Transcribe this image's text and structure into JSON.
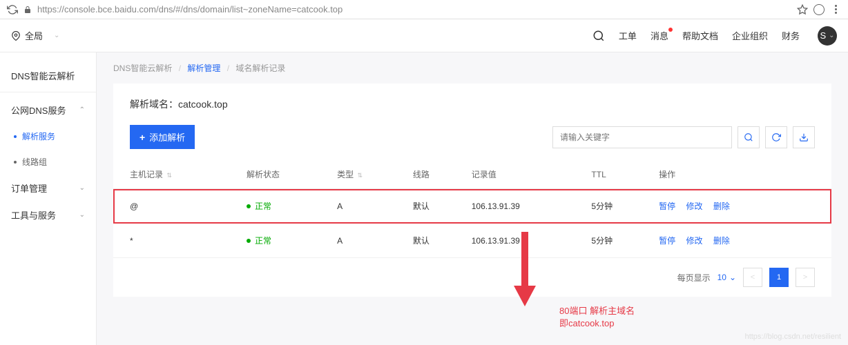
{
  "browser": {
    "url": "https://console.bce.baidu.com/dns/#/dns/domain/list~zoneName=catcook.top"
  },
  "header": {
    "region": "全局",
    "links": {
      "workorder": "工单",
      "messages": "消息",
      "help": "帮助文档",
      "org": "企业组织",
      "finance": "财务"
    },
    "avatar_letter": "S"
  },
  "sidebar": {
    "title": "DNS智能云解析",
    "sections": [
      {
        "label": "公网DNS服务",
        "expanded": true,
        "items": [
          {
            "label": "解析服务",
            "active": true
          },
          {
            "label": "线路组",
            "active": false
          }
        ]
      },
      {
        "label": "订单管理",
        "expanded": false
      },
      {
        "label": "工具与服务",
        "expanded": false
      }
    ]
  },
  "breadcrumb": {
    "items": [
      "DNS智能云解析",
      "解析管理",
      "域名解析记录"
    ]
  },
  "domain": {
    "label": "解析域名：",
    "value": "catcook.top"
  },
  "toolbar": {
    "add_label": "添加解析",
    "search_placeholder": "请输入关键字"
  },
  "table": {
    "columns": {
      "host": "主机记录",
      "status": "解析状态",
      "type": "类型",
      "line": "线路",
      "value": "记录值",
      "ttl": "TTL",
      "actions": "操作"
    },
    "status_text": "正常",
    "actions": {
      "pause": "暂停",
      "modify": "修改",
      "delete": "删除"
    },
    "rows": [
      {
        "host": "@",
        "type": "A",
        "line": "默认",
        "value": "106.13.91.39",
        "ttl": "5分钟"
      },
      {
        "host": "*",
        "type": "A",
        "line": "默认",
        "value": "106.13.91.39",
        "ttl": "5分钟"
      }
    ]
  },
  "pagination": {
    "per_page_label": "每页显示",
    "per_page_value": "10",
    "current": "1"
  },
  "annotation": {
    "line1": "80端口 解析主域名",
    "line2": "即catcook.top"
  },
  "watermark": "https://blog.csdn.net/resilient"
}
